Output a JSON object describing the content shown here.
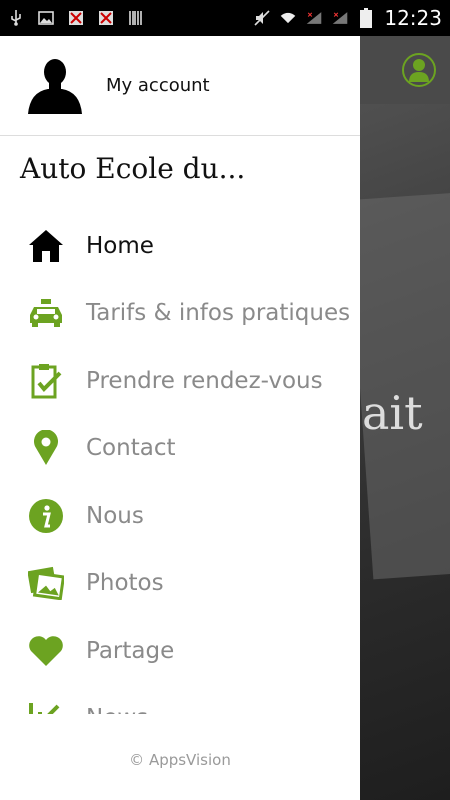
{
  "status_bar": {
    "time": "12:23",
    "icons": [
      "usb-icon",
      "image-icon",
      "missed-call-icon",
      "missed-call-icon",
      "barcode-icon",
      "mute-icon",
      "wifi-icon",
      "signal-icon",
      "signal-icon",
      "battery-icon"
    ]
  },
  "background": {
    "word": "ait"
  },
  "drawer": {
    "account_label": "My account",
    "app_title": "Auto Ecole du...",
    "items": [
      {
        "label": "Home",
        "icon": "home-icon",
        "active": true
      },
      {
        "label": "Tarifs & infos pratiques",
        "icon": "car-icon",
        "active": false
      },
      {
        "label": "Prendre rendez-vous",
        "icon": "clipboard-check-icon",
        "active": false
      },
      {
        "label": "Contact",
        "icon": "location-pin-icon",
        "active": false
      },
      {
        "label": "Nous",
        "icon": "info-icon",
        "active": false
      },
      {
        "label": "Photos",
        "icon": "photos-icon",
        "active": false
      },
      {
        "label": "Partage",
        "icon": "heart-icon",
        "active": false
      },
      {
        "label": "News",
        "icon": "news-icon",
        "active": false
      }
    ],
    "footer": "© AppsVision"
  },
  "colors": {
    "accent": "#6ca321",
    "active_text": "#111111",
    "inactive_text": "#8a8a8a"
  }
}
